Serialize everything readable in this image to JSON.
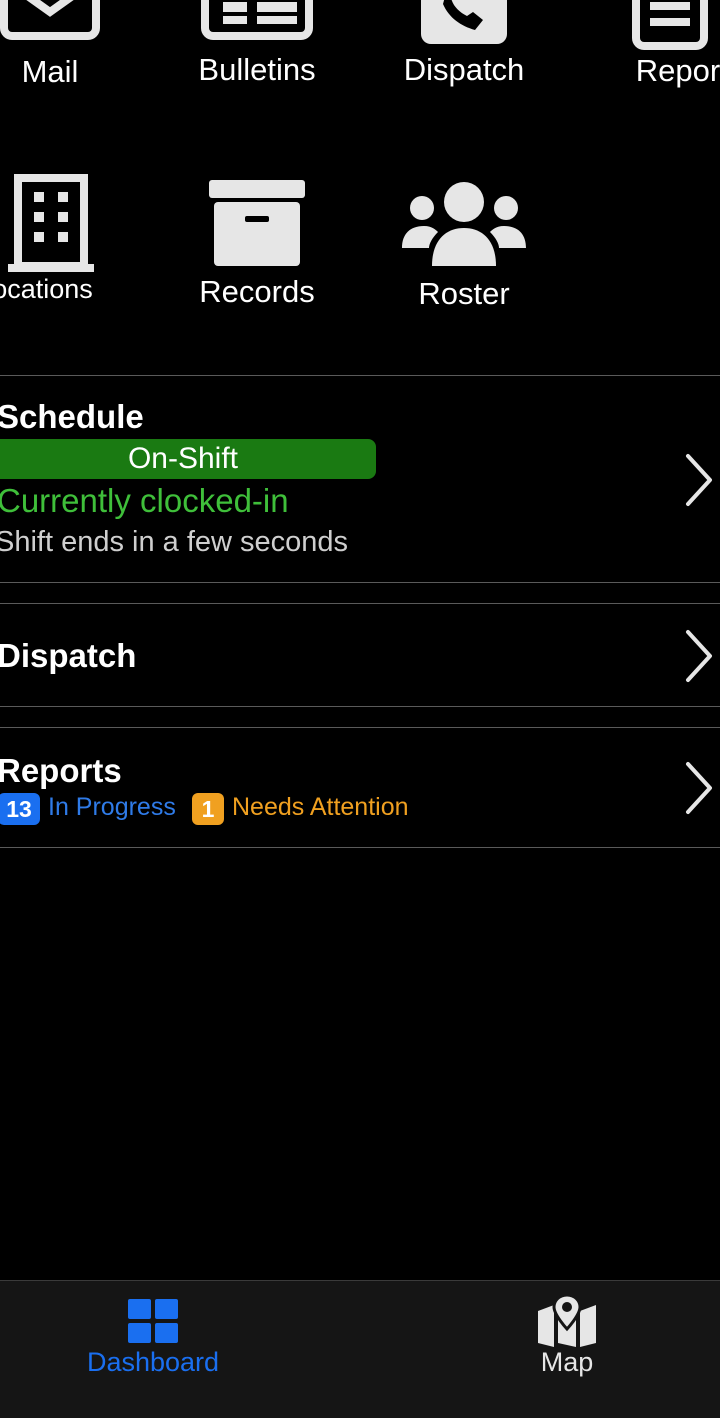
{
  "tiles": {
    "mail": {
      "label": "Mail",
      "icon": "envelope-icon"
    },
    "bulletins": {
      "label": "Bulletins",
      "icon": "newspaper-icon"
    },
    "dispatch": {
      "label": "Dispatch",
      "icon": "phone-icon"
    },
    "reports": {
      "label": "Reports",
      "icon": "document-icon"
    },
    "locations": {
      "label": "Locations",
      "icon": "building-icon"
    },
    "records": {
      "label": "Records",
      "icon": "archive-box-icon"
    },
    "roster": {
      "label": "Roster",
      "icon": "users-icon"
    }
  },
  "schedule": {
    "title": "Schedule",
    "status_pill": "On-Shift",
    "clock_status": "Currently clocked-in",
    "shift_ends": "Shift ends in a few seconds"
  },
  "dispatch": {
    "title": "Dispatch"
  },
  "reports": {
    "title": "Reports",
    "in_progress_count": "13",
    "in_progress_label": "In Progress",
    "attention_count": "1",
    "attention_label": "Needs Attention"
  },
  "tabbar": {
    "dashboard_label": "Dashboard",
    "map_label": "Map"
  },
  "colors": {
    "accent_blue": "#1a6ff0",
    "on_shift_green": "#1a7a12",
    "clocked_green": "#3fbf3a",
    "attention_orange": "#f0a020"
  }
}
